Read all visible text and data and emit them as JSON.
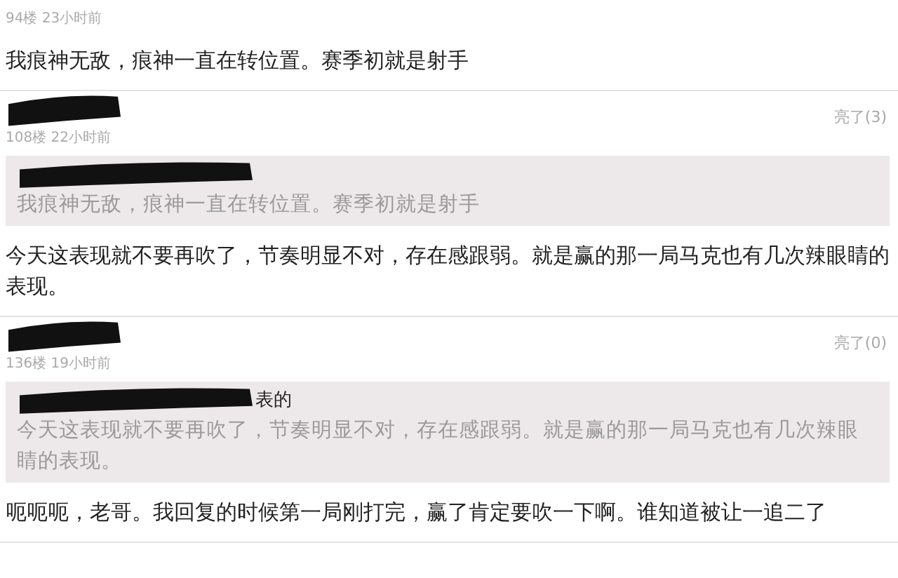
{
  "comments": [
    {
      "author_redacted": false,
      "meta": "94楼 23小时前",
      "body": "我痕神无敌，痕神一直在转位置。赛季初就是射手"
    },
    {
      "author_redacted": true,
      "likes": "亮了(3)",
      "meta": "108楼 22小时前",
      "quote": {
        "header_redacted": true,
        "text": "我痕神无敌，痕神一直在转位置。赛季初就是射手"
      },
      "body": "今天这表现就不要再吹了，节奏明显不对，存在感跟弱。就是赢的那一局马克也有几次辣眼睛的表现。"
    },
    {
      "author_redacted": true,
      "likes": "亮了(0)",
      "meta": "136楼 19小时前",
      "quote": {
        "header_redacted": true,
        "header": "表的",
        "text": "今天这表现就不要再吹了，节奏明显不对，存在感跟弱。就是赢的那一局马克也有几次辣眼睛的表现。"
      },
      "body": "呃呃呃，老哥。我回复的时候第一局刚打完，赢了肯定要吹一下啊。谁知道被让一追二了"
    }
  ]
}
